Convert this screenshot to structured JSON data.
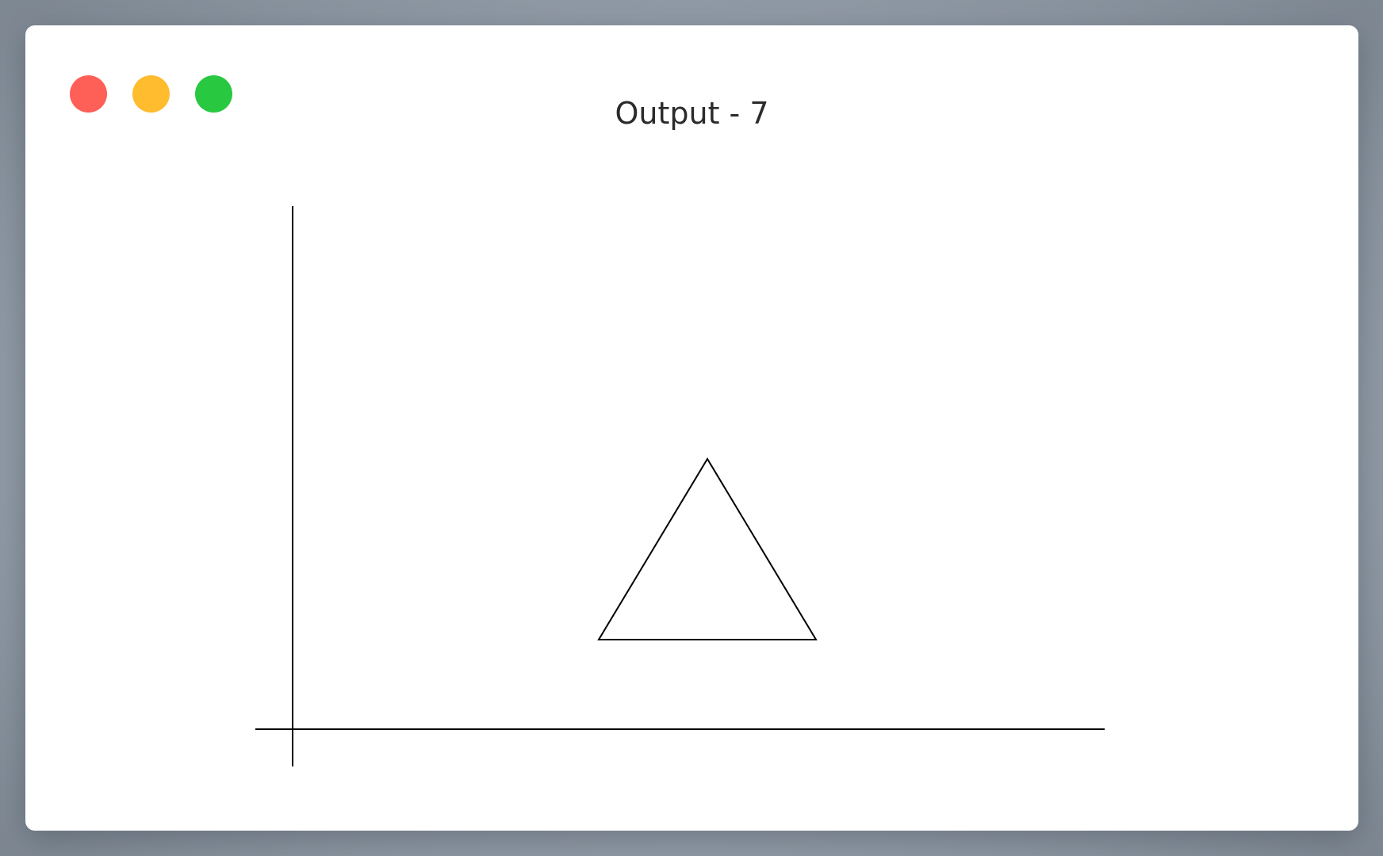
{
  "window": {
    "title": "Output - 7",
    "controls": {
      "close": {
        "icon": "close-dot-icon",
        "color": "#fe5f57"
      },
      "minimize": {
        "icon": "minimize-dot-icon",
        "color": "#febc2e"
      },
      "zoom": {
        "icon": "zoom-dot-icon",
        "color": "#28c840"
      }
    }
  }
}
